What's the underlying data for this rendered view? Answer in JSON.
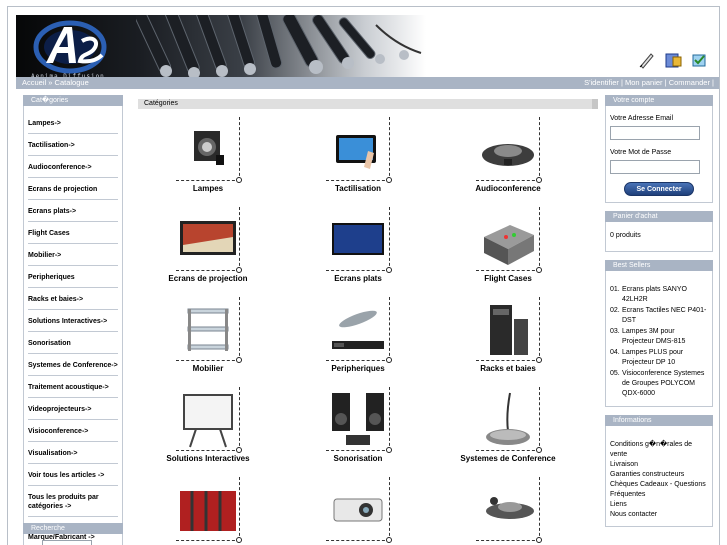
{
  "header": {
    "logo_text": "Aenima Diffusion"
  },
  "navbar": {
    "breadcrumb_home": "Accueil",
    "breadcrumb_sep": "»",
    "breadcrumb_current": "Catalogue",
    "login": "S'identifier",
    "sep1": "|",
    "cart": "Mon panier",
    "sep2": "|",
    "order": "Commander",
    "sep3": "|"
  },
  "left": {
    "categories_title": "Cat�gories",
    "categories": [
      "Lampes->",
      "Tactilisation->",
      "Audioconference->",
      "Ecrans de projection",
      "Ecrans plats->",
      "Flight Cases",
      "Mobilier->",
      "Peripheriques",
      "Racks et baies->",
      "Solutions Interactives->",
      "Sonorisation",
      "Systemes de Conference->",
      "Traitement acoustique->",
      "Videoprojecteurs->",
      "Visioconference->",
      "Visualisation->",
      "Voir tous les articles ->",
      "Tous les produits par catégories ->",
      "Tous les produits par Marque/Fabricant ->"
    ],
    "search_title": "Recherche"
  },
  "center": {
    "title": "Catégories",
    "items": [
      {
        "label": "Lampes"
      },
      {
        "label": "Tactilisation"
      },
      {
        "label": "Audioconference"
      },
      {
        "label": "Ecrans de projection"
      },
      {
        "label": "Ecrans plats"
      },
      {
        "label": "Flight Cases"
      },
      {
        "label": "Mobilier"
      },
      {
        "label": "Peripheriques"
      },
      {
        "label": "Racks et baies"
      },
      {
        "label": "Solutions Interactives"
      },
      {
        "label": "Sonorisation"
      },
      {
        "label": "Systemes de Conference"
      },
      {
        "label": ""
      },
      {
        "label": ""
      },
      {
        "label": ""
      }
    ]
  },
  "right": {
    "account_title": "Votre compte",
    "email_label": "Votre Adresse Email",
    "password_label": "Votre Mot de Passe",
    "login_button": "Se Connecter",
    "cart_title": "Panier d'achat",
    "cart_text": "0 produits",
    "bestsellers_title": "Best Sellers",
    "bestsellers": [
      {
        "num": "01.",
        "text": "Ecrans plats SANYO 42LH2R"
      },
      {
        "num": "02.",
        "text": "Ecrans Tactiles NEC P401-DST"
      },
      {
        "num": "03.",
        "text": "Lampes 3M pour Projecteur DMS-815"
      },
      {
        "num": "04.",
        "text": "Lampes PLUS pour Projecteur DP 10"
      },
      {
        "num": "05.",
        "text": "Visioconference Systemes de Groupes POLYCOM QDX-6000"
      }
    ],
    "info_title": "Informations",
    "info_links": [
      "Conditions g�n�rales de vente",
      "Livraison",
      "Garanties constructeurs",
      "Chèques Cadeaux - Questions Fréquentes",
      "Liens",
      "Nous contacter"
    ]
  }
}
